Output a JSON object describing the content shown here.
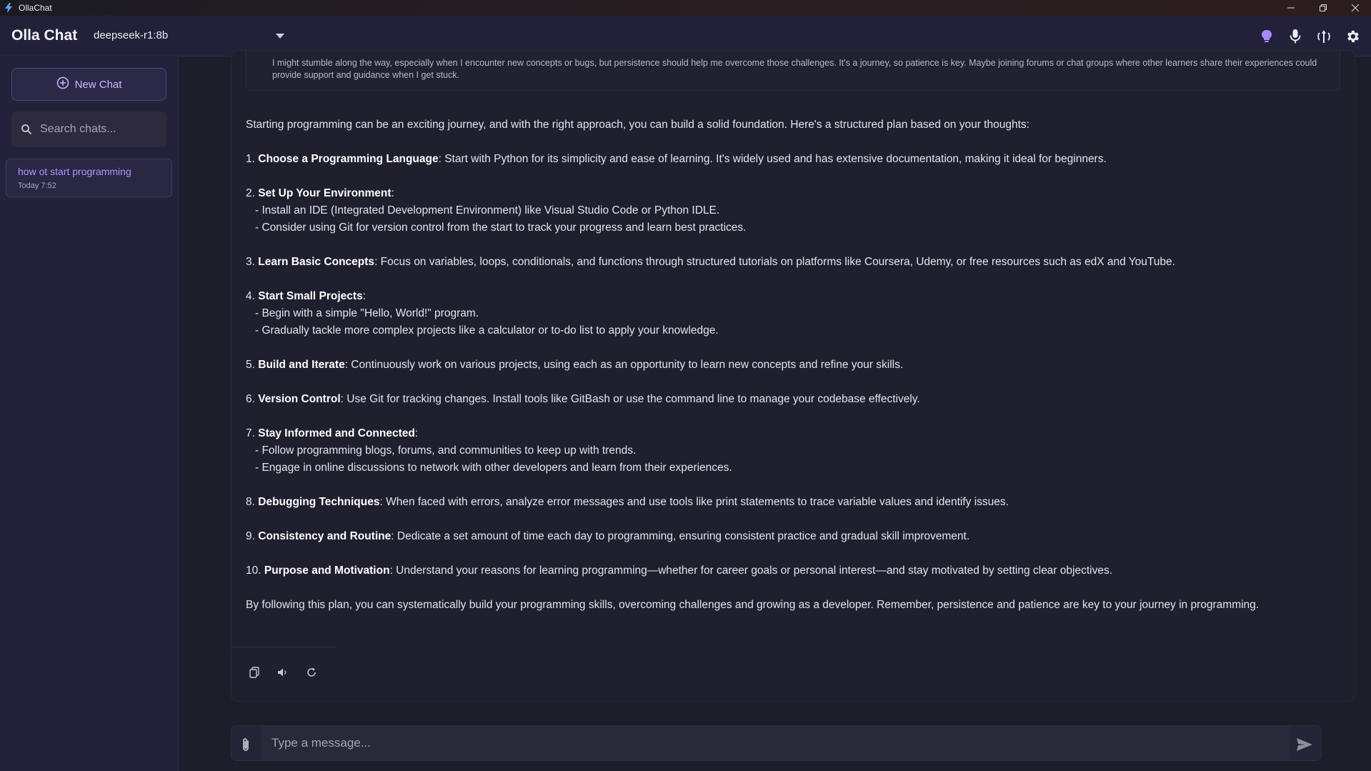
{
  "window": {
    "title": "OllaChat",
    "controls": [
      "minimize-icon",
      "restore-icon",
      "close-icon"
    ]
  },
  "header": {
    "brand": "Olla Chat",
    "model": "deepseek-r1:8b",
    "icons": [
      "bulb-icon",
      "microphone-icon",
      "voice-mode-icon",
      "gear-icon"
    ],
    "accent": "#a78bfa"
  },
  "sidebar": {
    "new_chat_label": "New Chat",
    "search_placeholder": "Search chats...",
    "chats": [
      {
        "title": "how ot start programming",
        "date": "Today 7:52"
      }
    ]
  },
  "thinking": {
    "text": "I might stumble along the way, especially when I encounter new concepts or bugs, but persistence should help me overcome those challenges. It's a journey, so patience is key. Maybe joining forums or chat groups where other learners share their experiences could provide support and guidance when I get stuck."
  },
  "response": {
    "intro": "Starting programming can be an exciting journey, and with the right approach, you can build a solid foundation. Here's a structured plan based on your thoughts:",
    "items": [
      {
        "num": "1.",
        "title": "Choose a Programming Language",
        "text": ": Start with Python for its simplicity and ease of learning. It's widely used and has extensive documentation, making it ideal for beginners.",
        "subs": []
      },
      {
        "num": "2.",
        "title": "Set Up Your Environment",
        "text": ":",
        "subs": [
          "- Install an IDE (Integrated Development Environment) like Visual Studio Code or Python IDLE.",
          "- Consider using Git for version control from the start to track your progress and learn best practices."
        ]
      },
      {
        "num": "3.",
        "title": "Learn Basic Concepts",
        "text": ": Focus on variables, loops, conditionals, and functions through structured tutorials on platforms like Coursera, Udemy, or free resources such as edX and YouTube.",
        "subs": []
      },
      {
        "num": "4.",
        "title": "Start Small Projects",
        "text": ":",
        "subs": [
          "- Begin with a simple \"Hello, World!\" program.",
          "- Gradually tackle more complex projects like a calculator or to-do list to apply your knowledge."
        ]
      },
      {
        "num": "5.",
        "title": "Build and Iterate",
        "text": ": Continuously work on various projects, using each as an opportunity to learn new concepts and refine your skills.",
        "subs": []
      },
      {
        "num": "6.",
        "title": "Version Control",
        "text": ": Use Git for tracking changes. Install tools like GitBash or use the command line to manage your codebase effectively.",
        "subs": []
      },
      {
        "num": "7.",
        "title": "Stay Informed and Connected",
        "text": ":",
        "subs": [
          "- Follow programming blogs, forums, and communities to keep up with trends.",
          "- Engage in online discussions to network with other developers and learn from their experiences."
        ]
      },
      {
        "num": "8.",
        "title": "Debugging Techniques",
        "text": ": When faced with errors, analyze error messages and use tools like print statements to trace variable values and identify issues.",
        "subs": []
      },
      {
        "num": "9.",
        "title": "Consistency and Routine",
        "text": ": Dedicate a set amount of time each day to programming, ensuring consistent practice and gradual skill improvement.",
        "subs": []
      },
      {
        "num": "10.",
        "title": "Purpose and Motivation",
        "text": ": Understand your reasons for learning programming—whether for career goals or personal interest—and stay motivated by setting clear objectives.",
        "subs": []
      }
    ],
    "outro": "By following this plan, you can systematically build your programming skills, overcoming challenges and growing as a developer. Remember, persistence and patience are key to your journey in programming."
  },
  "message_actions": [
    "copy-icon",
    "speaker-icon",
    "regenerate-icon"
  ],
  "composer": {
    "placeholder": "Type a message...",
    "value": ""
  }
}
